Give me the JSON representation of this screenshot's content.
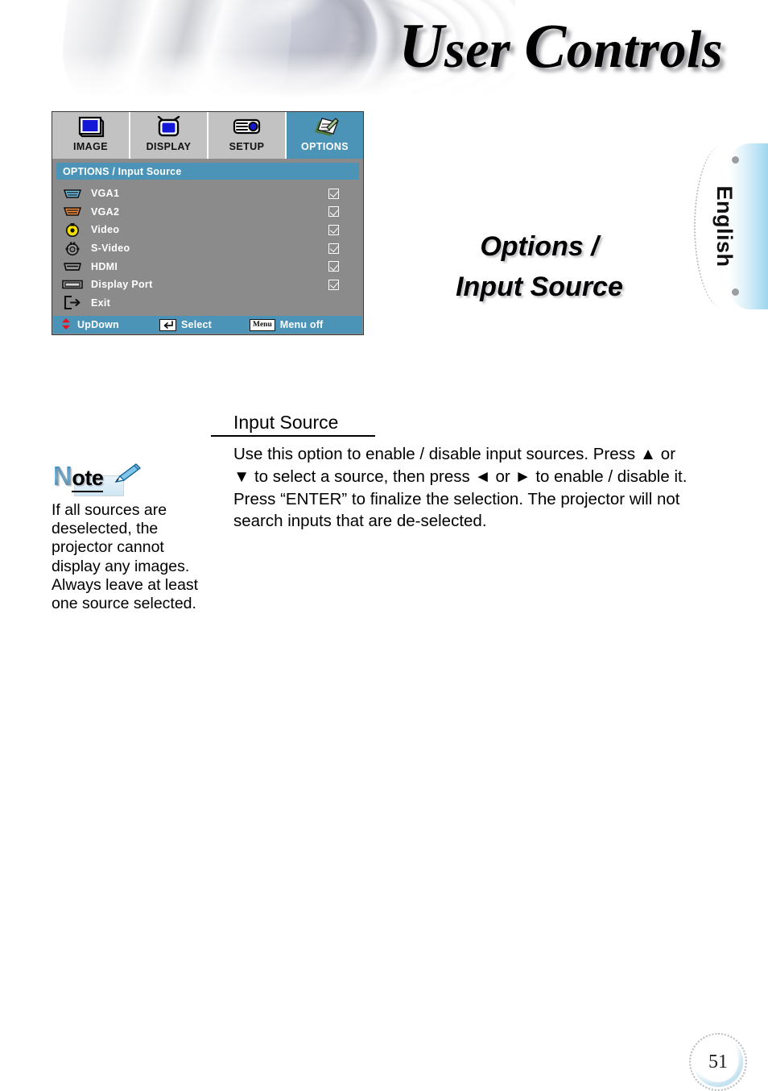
{
  "banner": {
    "title_cap1": "U",
    "title_rest1": "ser ",
    "title_cap2": "C",
    "title_rest2": "ontrols",
    "title_full": "User Controls"
  },
  "language_tab": {
    "label": "English"
  },
  "section_heading": {
    "line1": "Options /",
    "line2": "Input Source"
  },
  "osd": {
    "tabs": [
      {
        "label": "IMAGE",
        "icon": "monitor-icon",
        "active": false
      },
      {
        "label": "DISPLAY",
        "icon": "tv-icon",
        "active": false
      },
      {
        "label": "SETUP",
        "icon": "projector-icon",
        "active": false
      },
      {
        "label": "OPTIONS",
        "icon": "document-pencil-icon",
        "active": true
      }
    ],
    "title": "OPTIONS / Input Source",
    "rows": [
      {
        "label": "VGA1",
        "icon": "vga-blue-icon",
        "checked": true
      },
      {
        "label": "VGA2",
        "icon": "vga-orange-icon",
        "checked": true
      },
      {
        "label": "Video",
        "icon": "rca-yellow-icon",
        "checked": true
      },
      {
        "label": "S-Video",
        "icon": "s-video-icon",
        "checked": true
      },
      {
        "label": "HDMI",
        "icon": "hdmi-icon",
        "checked": true
      },
      {
        "label": "Display Port",
        "icon": "display-port-icon",
        "checked": true
      },
      {
        "label": "Exit",
        "icon": "exit-door-icon",
        "checked": false
      }
    ],
    "footer": {
      "updown_label": "UpDown",
      "select_label": "Select",
      "menuoff_label": "Menu off",
      "menu_key_text": "Menu"
    },
    "colors": {
      "accent_blue": "#4b94b8",
      "panel_gray": "#8b8b8b",
      "tab_gray": "#c2c2c2"
    }
  },
  "note": {
    "word_big": "N",
    "word_rest": "ote",
    "text": "If all sources are deselected, the projector cannot display any images. Always leave at least one source selected."
  },
  "content": {
    "sub_heading": "Input Source",
    "paragraph": "Use this option to enable / disable input sources. Press ▲ or ▼ to select a source, then press ◄ or ► to enable / disable it. Press “ENTER” to finalize the selection. The projector will not search inputs that are de-selected."
  },
  "page_number": "51"
}
